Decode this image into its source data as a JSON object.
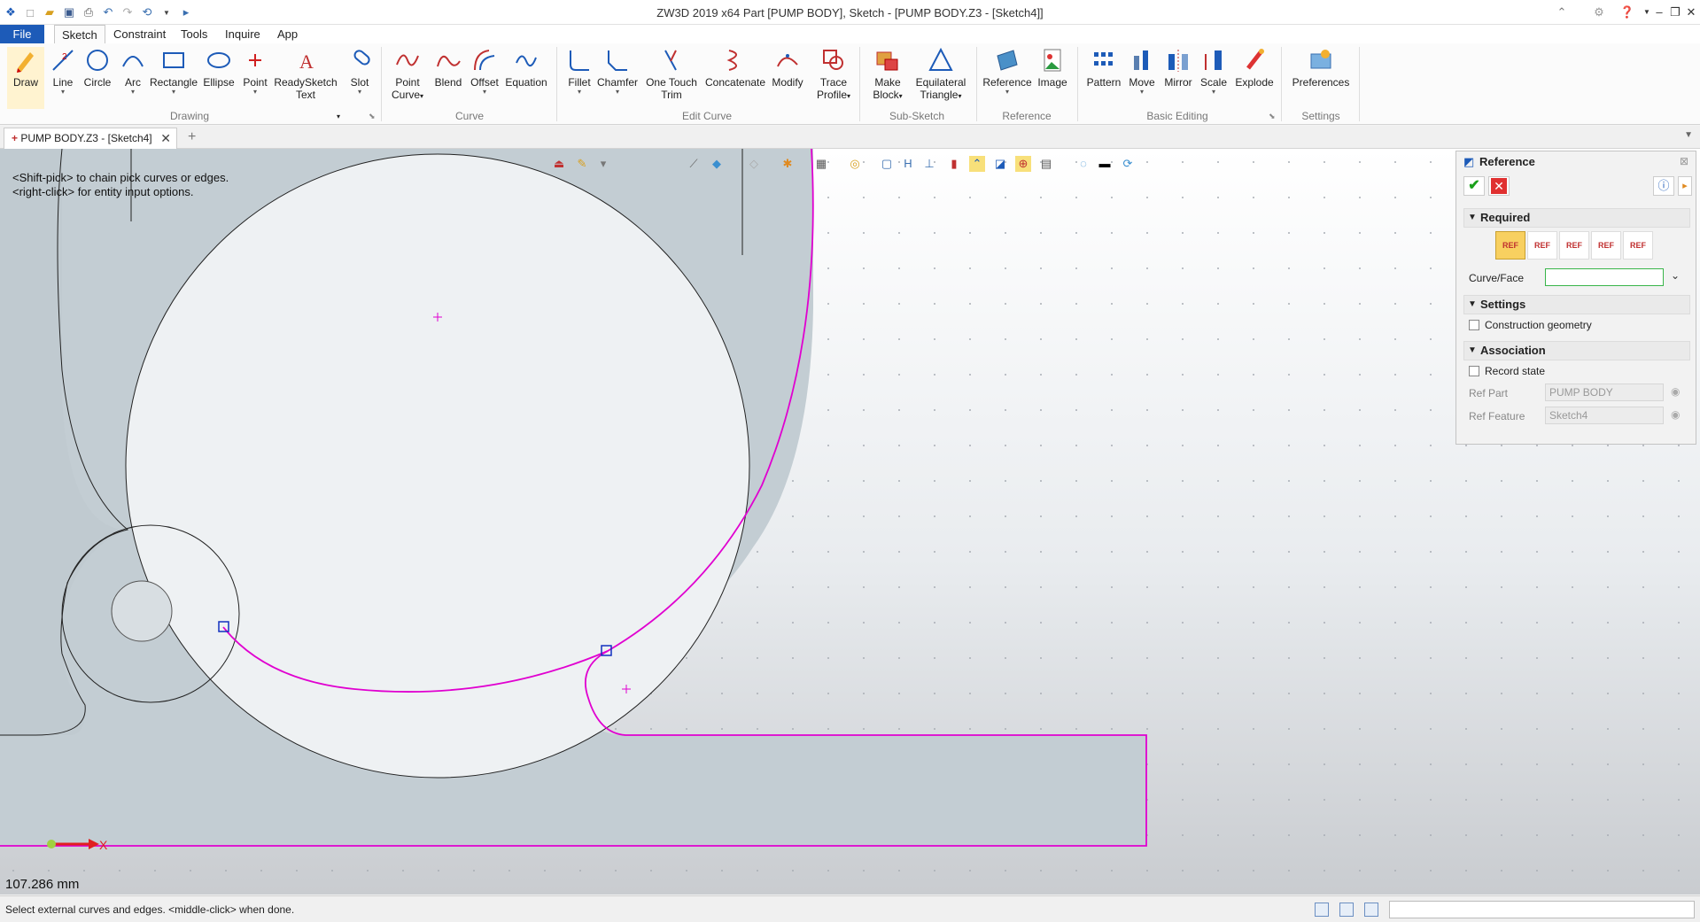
{
  "window": {
    "title": "ZW3D 2019  x64        Part [PUMP BODY],  Sketch - [PUMP BODY.Z3 - [Sketch4]]"
  },
  "menu": {
    "file": "File",
    "tabs": [
      "Sketch",
      "Constraint",
      "Tools",
      "Inquire",
      "App"
    ],
    "active": "Sketch"
  },
  "ribbon": {
    "groups": {
      "drawing": "Drawing",
      "curve": "Curve",
      "edit_curve": "Edit Curve",
      "sub_sketch": "Sub-Sketch",
      "reference": "Reference",
      "basic_editing": "Basic Editing",
      "settings": "Settings"
    },
    "buttons": {
      "draw": "Draw",
      "line": "Line",
      "circle": "Circle",
      "arc": "Arc",
      "rectangle": "Rectangle",
      "ellipse": "Ellipse",
      "point": "Point",
      "readysketch_1": "ReadySketch",
      "readysketch_2": "Text",
      "slot": "Slot",
      "point_curve_1": "Point",
      "point_curve_2": "Curve",
      "blend": "Blend",
      "offset": "Offset",
      "equation": "Equation",
      "fillet": "Fillet",
      "chamfer": "Chamfer",
      "one_touch_1": "One Touch",
      "one_touch_2": "Trim",
      "concatenate": "Concatenate",
      "modify": "Modify",
      "trace_1": "Trace",
      "trace_2": "Profile",
      "make_block_1": "Make",
      "make_block_2": "Block",
      "eq_tri_1": "Equilateral",
      "eq_tri_2": "Triangle",
      "reference": "Reference",
      "image": "Image",
      "pattern": "Pattern",
      "move": "Move",
      "mirror": "Mirror",
      "scale": "Scale",
      "explode": "Explode",
      "preferences": "Preferences"
    }
  },
  "document_tab": {
    "label": "PUMP BODY.Z3 - [Sketch4]"
  },
  "viewport": {
    "hint_1": "<Shift-pick> to chain pick curves or edges.",
    "hint_2": "<right-click> for entity input options.",
    "axis_label": "X",
    "measurement": "107.286 mm"
  },
  "reference_panel": {
    "title": "Reference",
    "required": "Required",
    "curve_face_label": "Curve/Face",
    "curve_face_value": "",
    "settings": "Settings",
    "construction_geometry": "Construction geometry",
    "association": "Association",
    "record_state": "Record state",
    "ref_part_label": "Ref Part",
    "ref_part_value": "PUMP BODY",
    "ref_feature_label": "Ref Feature",
    "ref_feature_value": "Sketch4"
  },
  "status": {
    "message": "Select external curves and edges.  <middle-click> when done."
  },
  "colors": {
    "accent": "#1d5bb8",
    "highlight_curve": "#e000d0",
    "part_fill": "#c3cdd3"
  }
}
